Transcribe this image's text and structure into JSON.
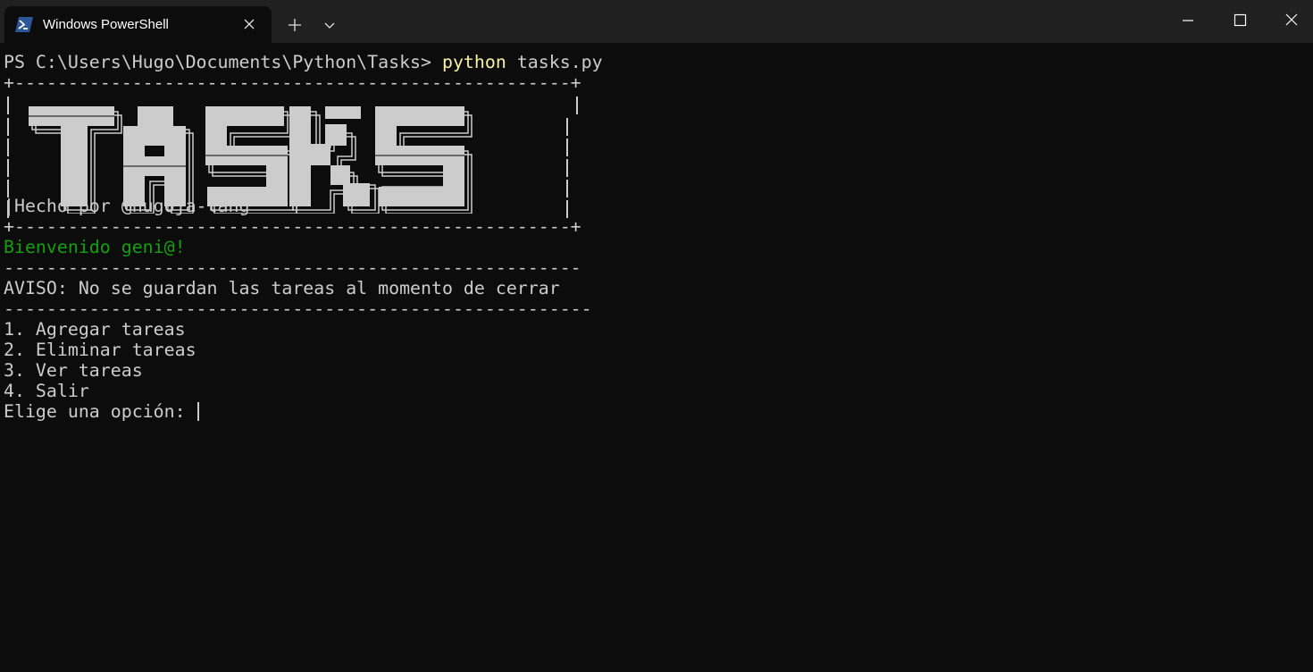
{
  "window": {
    "tab_title": "Windows PowerShell"
  },
  "terminal": {
    "prompt": "PS C:\\Users\\Hugo\\Documents\\Python\\Tasks> ",
    "command": "python",
    "args": " tasks.py",
    "border_top": "+----------------------------------------------------+",
    "border_bottom": "+----------------------------------------------------+",
    "banner_word": "TASKS",
    "credit": "|Hecho por @hugoja-lang",
    "welcome": "Bienvenido geni@!",
    "separator_1": "------------------------------------------------------",
    "warning": "AVISO: No se guardan las tareas al momento de cerrar",
    "separator_2": "-------------------------------------------------------",
    "menu": [
      "1. Agregar tareas",
      "2. Eliminar tareas",
      "3. Ver tareas",
      "4. Salir"
    ],
    "input_prompt": "Elige una opción: "
  },
  "colors": {
    "background": "#0c0c0c",
    "titlebar": "#202020",
    "text": "#cccccc",
    "command": "#f9f1a5",
    "success": "#13a10e",
    "powershell_icon": "#2b5797"
  },
  "icons": [
    "powershell-icon",
    "close-icon",
    "plus-icon",
    "chevron-down-icon",
    "minimize-icon",
    "maximize-icon",
    "close-window-icon"
  ]
}
